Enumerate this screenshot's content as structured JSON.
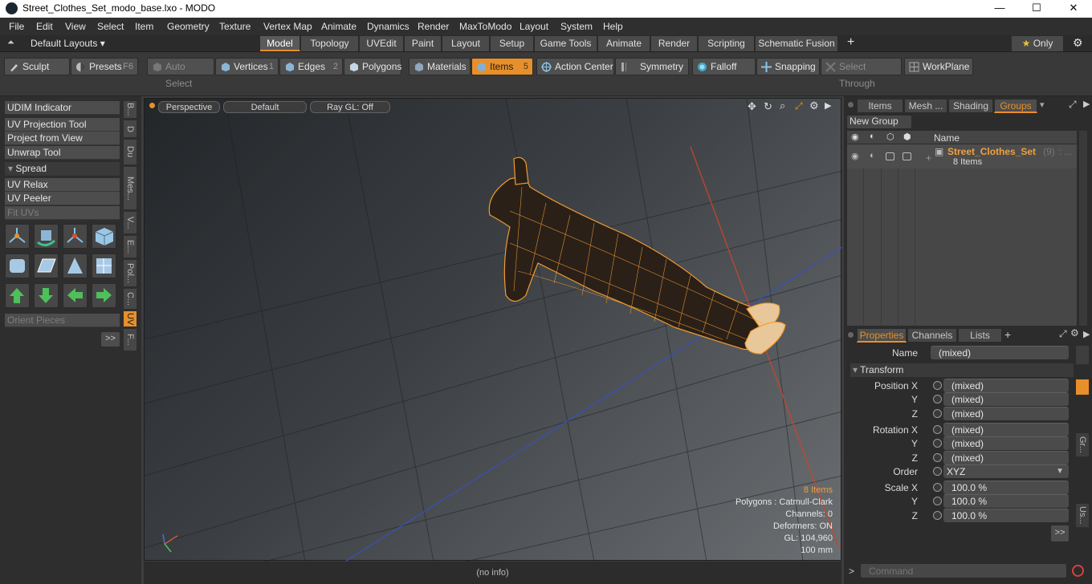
{
  "window": {
    "title": "Street_Clothes_Set_modo_base.lxo - MODO",
    "minimize": "—",
    "maximize": "☐",
    "close": "✕"
  },
  "menu": [
    "File",
    "Edit",
    "View",
    "Select",
    "Item",
    "Geometry",
    "Texture",
    "Vertex Map",
    "Animate",
    "Dynamics",
    "Render",
    "MaxToModo",
    "Layout",
    "System",
    "Help"
  ],
  "layout_selector": "Default Layouts ▾",
  "layout_tabs": [
    "Model",
    "Topology",
    "UVEdit",
    "Paint",
    "Layout",
    "Setup",
    "Game Tools",
    "Animate",
    "Render",
    "Scripting",
    "Schematic Fusion"
  ],
  "add_tab": "+",
  "only_label": "Only",
  "toolbar": {
    "sculpt": "Sculpt",
    "presets": "Presets",
    "presets_key": "F6",
    "auto_select": "Auto Select",
    "vertices": "Vertices",
    "vertices_num": "1",
    "edges": "Edges",
    "edges_num": "2",
    "polygons": "Polygons",
    "materials": "Materials",
    "items": "Items",
    "items_num": "5",
    "action_center": "Action Center",
    "symmetry": "Symmetry",
    "falloff": "Falloff",
    "snapping": "Snapping",
    "select_through": "Select Through",
    "workplane": "WorkPlane"
  },
  "left_tools": {
    "udim": "UDIM Indicator",
    "uv_projection": "UV Projection Tool",
    "project_view": "Project from View",
    "unwrap": "Unwrap Tool",
    "spread": "Spread",
    "uv_relax": "UV Relax",
    "uv_peeler": "UV Peeler",
    "fit_uvs": "Fit UVs",
    "orient": "Orient Pieces",
    "more": ">>"
  },
  "left_vtabs": [
    "B...",
    "D",
    "Du",
    "Mes...",
    "V...",
    "E...",
    "Pol...",
    "C...",
    "UV",
    "F..."
  ],
  "viewport": {
    "view": "Perspective",
    "shading": "Default",
    "raygl": "Ray GL: Off",
    "info": {
      "items": "8 Items",
      "polygons": "Polygons : Catmull-Clark",
      "channels": "Channels: 0",
      "deformers": "Deformers: ON",
      "gl": "GL: 104,960",
      "scale": "100 mm"
    }
  },
  "status": "(no info)",
  "right_top_tabs": [
    "Items",
    "Mesh ...",
    "Shading",
    "Groups"
  ],
  "groups": {
    "new_group": "New Group",
    "col_name": "Name",
    "item_name": "Street_Clothes_Set",
    "item_count": "(9)",
    "item_dots": ": ...",
    "item_sub": "8 Items"
  },
  "props_tabs": [
    "Properties",
    "Channels",
    "Lists"
  ],
  "properties": {
    "name_label": "Name",
    "name_value": "(mixed)",
    "transform": "Transform",
    "position_x_label": "Position X",
    "y_label": "Y",
    "z_label": "Z",
    "rotation_x_label": "Rotation X",
    "order_label": "Order",
    "scale_x_label": "Scale X",
    "mixed": "(mixed)",
    "order_value": "XYZ",
    "scale_value": "100.0 %",
    "more": ">>"
  },
  "right_vtabs": [
    "Gr...",
    "Us..."
  ],
  "command": {
    "prompt": ">",
    "placeholder": "Command"
  }
}
